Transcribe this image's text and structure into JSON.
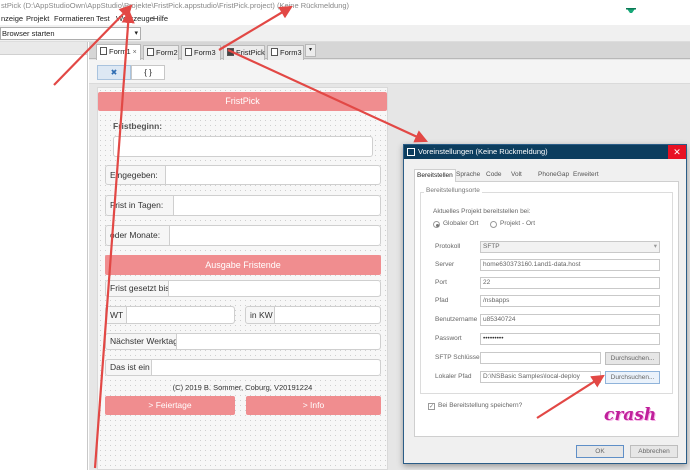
{
  "window": {
    "title": "stPick (D:\\AppStudioOwn\\AppStudio\\Projekte\\FristPick.appstudio\\FristPick.project) (Keine Rückmeldung)"
  },
  "menu": [
    "nzeige",
    "Projekt",
    "Formatieren",
    "Test",
    "Werkzeuge",
    "Hilfe"
  ],
  "toolbar": {
    "browser_select": "Browser starten"
  },
  "tabs": [
    {
      "label": "Form1",
      "active": true,
      "close": "×",
      "icon": "form-icon"
    },
    {
      "label": "Form2",
      "active": false,
      "close": "",
      "icon": "form-icon"
    },
    {
      "label": "Form3",
      "active": false,
      "close": "",
      "icon": "form-icon"
    },
    {
      "label": "FristPick",
      "active": false,
      "close": "",
      "icon": "project-icon"
    },
    {
      "label": "Form3",
      "active": false,
      "close": "",
      "icon": "form-icon"
    }
  ],
  "tab_more": "▾",
  "subtoolbar": {
    "design_icon": "✖",
    "code_label": "{ }"
  },
  "form": {
    "header": "FristPick",
    "fristbeginn_label": "Fristbeginn:",
    "eingegeben_label": "Eingegeben:",
    "frist_tagen_label": "Frist in Tagen:",
    "monate_label": "oder Monate:",
    "ausgabe_button": "Ausgabe Fristende",
    "frist_gesetzt_label": "Frist gesetzt bis",
    "wt_label": "WT",
    "kw_label": "in KW",
    "naechster_label": "Nächster Werktag:",
    "das_ist_label": "Das ist ein",
    "copyright": "(C) 2019 B. Sommer, Coburg, V20191224",
    "feiertage_button": "> Feiertage",
    "info_button": "> Info"
  },
  "dialog": {
    "title": "Voreinstellungen (Keine Rückmeldung)",
    "close": "✕",
    "tabs": [
      "Bereitstellen",
      "Sprache",
      "Code",
      "Volt",
      "PhoneGap",
      "Erweitert"
    ],
    "section": "Bereitstellungsorte",
    "current_project_label": "Aktuelles Projekt bereitstellen bei:",
    "radio_global": "Globaler Ort",
    "radio_project": "Projekt - Ort",
    "protokoll_label": "Protokoll",
    "protokoll_value": "SFTP",
    "server_label": "Server",
    "server_value": "home630373160.1and1-data.host",
    "port_label": "Port",
    "port_value": "22",
    "pfad_label": "Pfad",
    "pfad_value": "/nsbapps",
    "benutzername_label": "Benutzername",
    "benutzername_value": "u85340724",
    "passwort_label": "Passwort",
    "passwort_value": "•••••••••",
    "sftp_label": "SFTP Schlüssel",
    "sftp_value": "",
    "lokaler_label": "Lokaler Pfad",
    "lokaler_value": "D:\\NSBasic Samples\\local-deploy",
    "browse_label": "Durchsuchen...",
    "checkbox_label": "Bei Bereitstellung speichern?",
    "ok_label": "OK",
    "cancel_label": "Abbrechen"
  },
  "watermark": "crash",
  "colors": {
    "accent_pink": "#f08d8f",
    "dialog_title": "#0c3d5e",
    "arrow": "#e24845",
    "watermark": "#c01f9b"
  }
}
